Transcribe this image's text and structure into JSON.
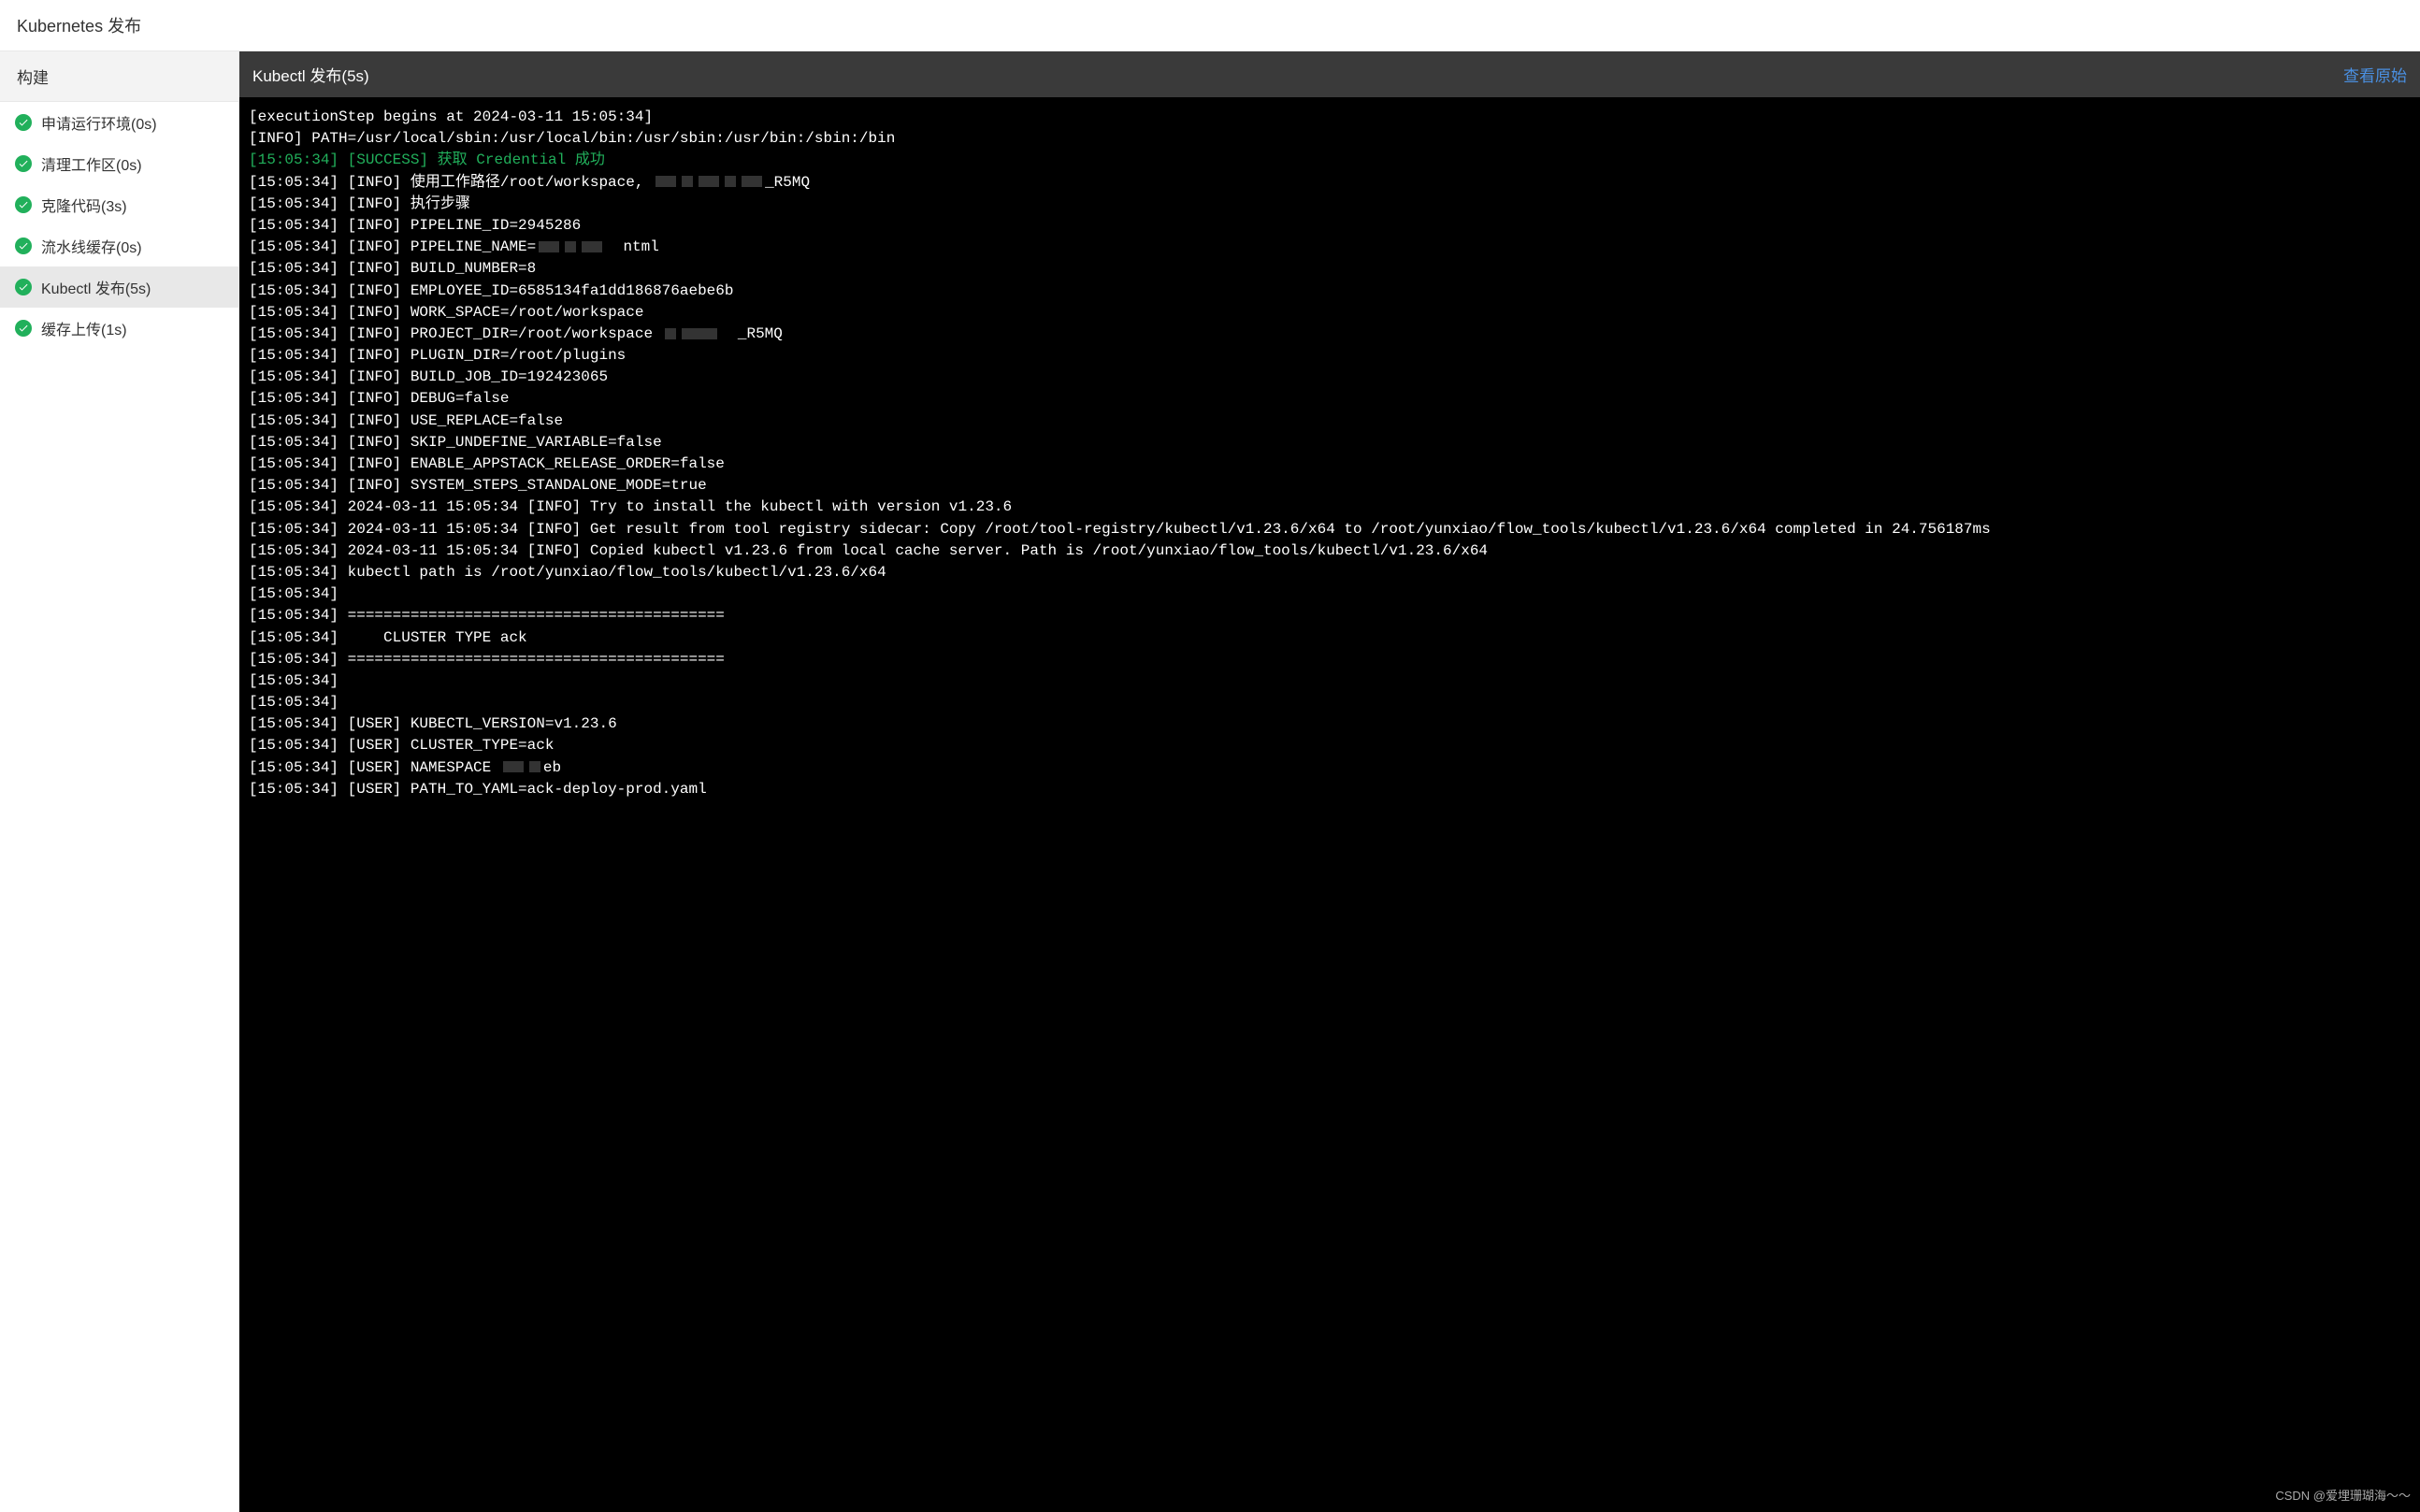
{
  "page_title": "Kubernetes 发布",
  "sidebar": {
    "header": "构建",
    "items": [
      {
        "label": "申请运行环境(0s)",
        "status": "success",
        "active": false
      },
      {
        "label": "清理工作区(0s)",
        "status": "success",
        "active": false
      },
      {
        "label": "克隆代码(3s)",
        "status": "success",
        "active": false
      },
      {
        "label": "流水线缓存(0s)",
        "status": "success",
        "active": false
      },
      {
        "label": "Kubectl 发布(5s)",
        "status": "success",
        "active": true
      },
      {
        "label": "缓存上传(1s)",
        "status": "success",
        "active": false
      }
    ]
  },
  "main": {
    "header": "Kubectl 发布(5s)",
    "view_original": "查看原始",
    "logs": [
      {
        "t": "plain",
        "text": "[executionStep begins at 2024-03-11 15:05:34]"
      },
      {
        "t": "plain",
        "text": "[INFO] PATH=/usr/local/sbin:/usr/local/bin:/usr/sbin:/usr/bin:/sbin:/bin"
      },
      {
        "t": "success",
        "text": "[15:05:34] [SUCCESS] 获取 Credential 成功"
      },
      {
        "t": "redacted",
        "prefix": "[15:05:34] [INFO] 使用工作路径/root/workspace, ",
        "blocks": [
          "m",
          "s",
          "m",
          "s",
          "m"
        ],
        "suffix": "_R5MQ"
      },
      {
        "t": "plain",
        "text": "[15:05:34] [INFO] 执行步骤"
      },
      {
        "t": "plain",
        "text": "[15:05:34] [INFO] PIPELINE_ID=2945286"
      },
      {
        "t": "redacted",
        "prefix": "[15:05:34] [INFO] PIPELINE_NAME=",
        "blocks": [
          "m",
          "s",
          "m"
        ],
        "suffix": "  ntml"
      },
      {
        "t": "plain",
        "text": "[15:05:34] [INFO] BUILD_NUMBER=8"
      },
      {
        "t": "plain",
        "text": "[15:05:34] [INFO] EMPLOYEE_ID=6585134fa1dd186876aebe6b"
      },
      {
        "t": "plain",
        "text": "[15:05:34] [INFO] WORK_SPACE=/root/workspace"
      },
      {
        "t": "redacted",
        "prefix": "[15:05:34] [INFO] PROJECT_DIR=/root/workspace ",
        "blocks": [
          "s",
          "l"
        ],
        "suffix": "  _R5MQ"
      },
      {
        "t": "plain",
        "text": "[15:05:34] [INFO] PLUGIN_DIR=/root/plugins"
      },
      {
        "t": "plain",
        "text": "[15:05:34] [INFO] BUILD_JOB_ID=192423065"
      },
      {
        "t": "plain",
        "text": "[15:05:34] [INFO] DEBUG=false"
      },
      {
        "t": "plain",
        "text": "[15:05:34] [INFO] USE_REPLACE=false"
      },
      {
        "t": "plain",
        "text": "[15:05:34] [INFO] SKIP_UNDEFINE_VARIABLE=false"
      },
      {
        "t": "plain",
        "text": "[15:05:34] [INFO] ENABLE_APPSTACK_RELEASE_ORDER=false"
      },
      {
        "t": "plain",
        "text": "[15:05:34] [INFO] SYSTEM_STEPS_STANDALONE_MODE=true"
      },
      {
        "t": "plain",
        "text": "[15:05:34] 2024-03-11 15:05:34 [INFO] Try to install the kubectl with version v1.23.6"
      },
      {
        "t": "plain",
        "text": "[15:05:34] 2024-03-11 15:05:34 [INFO] Get result from tool registry sidecar: Copy /root/tool-registry/kubectl/v1.23.6/x64 to /root/yunxiao/flow_tools/kubectl/v1.23.6/x64 completed in 24.756187ms"
      },
      {
        "t": "plain",
        "text": "[15:05:34] 2024-03-11 15:05:34 [INFO] Copied kubectl v1.23.6 from local cache server. Path is /root/yunxiao/flow_tools/kubectl/v1.23.6/x64"
      },
      {
        "t": "plain",
        "text": "[15:05:34] kubectl path is /root/yunxiao/flow_tools/kubectl/v1.23.6/x64"
      },
      {
        "t": "plain",
        "text": "[15:05:34] "
      },
      {
        "t": "plain",
        "text": "[15:05:34] =========================================="
      },
      {
        "t": "plain",
        "text": "[15:05:34]     CLUSTER TYPE ack"
      },
      {
        "t": "plain",
        "text": "[15:05:34] =========================================="
      },
      {
        "t": "plain",
        "text": "[15:05:34] "
      },
      {
        "t": "plain",
        "text": "[15:05:34] "
      },
      {
        "t": "plain",
        "text": "[15:05:34] [USER] KUBECTL_VERSION=v1.23.6"
      },
      {
        "t": "plain",
        "text": "[15:05:34] [USER] CLUSTER_TYPE=ack"
      },
      {
        "t": "redacted",
        "prefix": "[15:05:34] [USER] NAMESPACE ",
        "blocks": [
          "m",
          "s"
        ],
        "suffix": "eb"
      },
      {
        "t": "plain",
        "text": "[15:05:34] [USER] PATH_TO_YAML=ack-deploy-prod.yaml"
      }
    ]
  },
  "watermark": "CSDN @爱埋珊瑚海～～"
}
